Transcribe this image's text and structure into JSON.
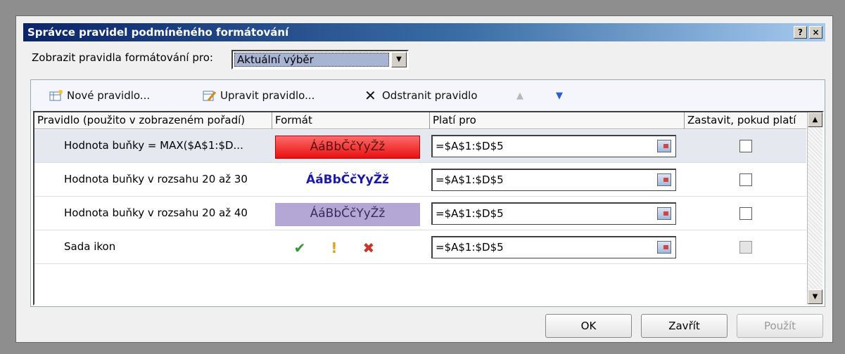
{
  "window": {
    "title": "Správce pravidel podmíněného formátování",
    "help_label": "?",
    "close_label": "×"
  },
  "show_rules": {
    "label": "Zobrazit pravidla formátování pro:",
    "selected": "Aktuální výběr"
  },
  "toolbar": {
    "new_rule": "Nové pravidlo...",
    "edit_rule": "Upravit pravidlo...",
    "delete_rule": "Odstranit pravidlo",
    "move_up_icon": "arrow-up-icon",
    "move_down_icon": "arrow-down-icon"
  },
  "table": {
    "columns": [
      "Pravidlo (použito v zobrazeném pořadí)",
      "Formát",
      "Platí pro",
      "Zastavit, pokud platí"
    ],
    "rows": [
      {
        "rule": "Hodnota buňky = MAX($A$1:$D...",
        "format": "ÁáBbČčYyŽž",
        "format_style": "red-fill",
        "applies_to": "=$A$1:$D$5",
        "stop_if_true": false,
        "selected": true
      },
      {
        "rule": "Hodnota buňky v rozsahu 20 až 30",
        "format": "ÁáBbČčYyŽž",
        "format_style": "blue-bold-text",
        "applies_to": "=$A$1:$D$5",
        "stop_if_true": false,
        "selected": false
      },
      {
        "rule": "Hodnota buňky v rozsahu 20 až 40",
        "format": "ÁáBbČčYyŽž",
        "format_style": "purple-fill",
        "applies_to": "=$A$1:$D$5",
        "stop_if_true": false,
        "selected": false
      },
      {
        "rule": "Sada ikon",
        "format_icons": [
          "✔",
          "!",
          "✖"
        ],
        "applies_to": "=$A$1:$D$5",
        "stop_if_true": false,
        "stop_disabled": true,
        "selected": false
      }
    ]
  },
  "buttons": {
    "ok": "OK",
    "close": "Zavřít",
    "apply": "Použít"
  },
  "colors": {
    "title_bar_start": "#0a246a",
    "red_fill": "#f42323",
    "purple_fill": "#b4a7d6",
    "blue_text": "#1a1aa6"
  }
}
